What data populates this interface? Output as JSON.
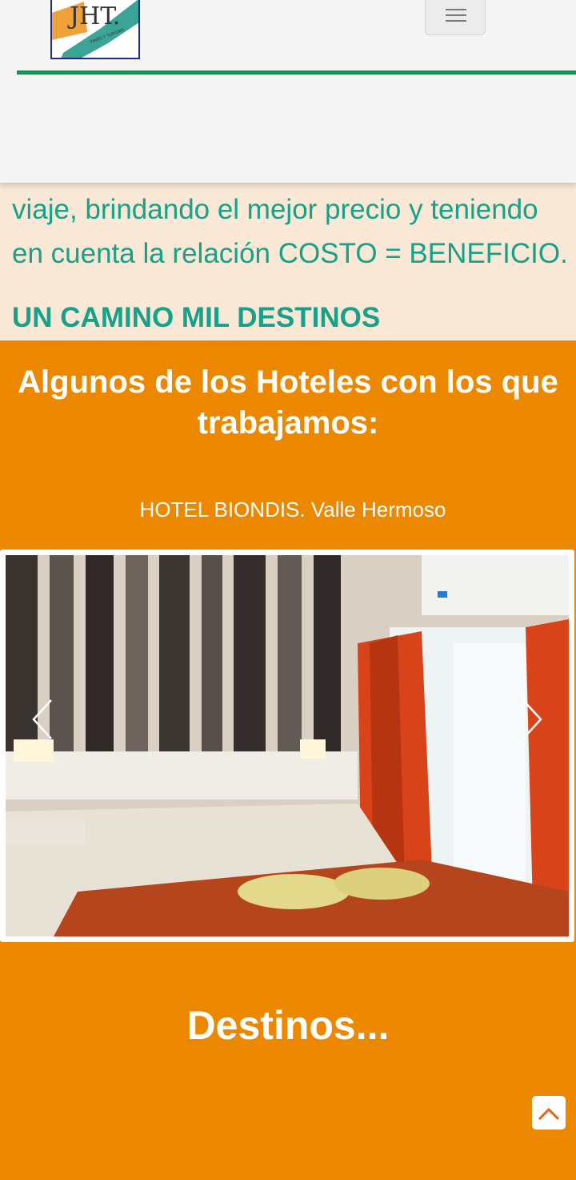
{
  "header": {
    "logo_text": "JHT.",
    "logo_subtext": "VIAJES Y TURISMO",
    "menu_icon": "hamburger-menu-icon"
  },
  "about": {
    "text": "viaje, brindando el mejor precio y teniendo en cuenta la relación COSTO = BENEFICIO.",
    "slogan": "UN CAMINO MIL DESTINOS"
  },
  "hotels": {
    "title": "Algunos de los Hoteles con los que trabajamos:",
    "current_hotel": "HOTEL BIONDIS. Valle Hermoso",
    "prev_icon": "chevron-left-icon",
    "next_icon": "chevron-right-icon"
  },
  "destinations": {
    "title": "Destinos..."
  },
  "scroll_top_icon": "chevron-up-icon",
  "colors": {
    "teal": "#17a08a",
    "orange": "#ec8800",
    "cream": "#f8e8d5",
    "nav_green": "#1d8a55",
    "up_arrow": "#e8621a"
  }
}
